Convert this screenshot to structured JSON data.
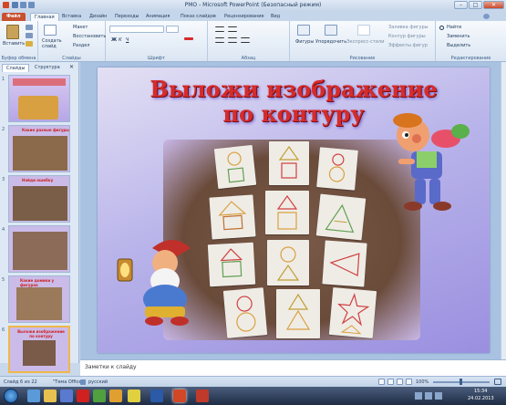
{
  "window": {
    "title": "РМО - Microsoft PowerPoint (Безопасный режим)",
    "controls": [
      "–",
      "□",
      "✕"
    ]
  },
  "tabs": [
    "Файл",
    "Главная",
    "Вставка",
    "Дизайн",
    "Переходы",
    "Анимация",
    "Показ слайдов",
    "Рецензирование",
    "Вид"
  ],
  "ribbon": {
    "clipboard": {
      "paste": "Вставить",
      "label": "Буфер обмена"
    },
    "slides": {
      "create": "Создать слайд",
      "layout": "Макет",
      "reset": "Восстановить",
      "section": "Раздел",
      "label": "Слайды"
    },
    "font": {
      "label": "Шрифт"
    },
    "paragraph": {
      "label": "Абзац"
    },
    "drawing": {
      "shapes": "Фигуры",
      "arrange": "Упорядочить",
      "quickstyles": "Экспресс-стили",
      "fill": "Заливка фигуры",
      "outline": "Контур фигуры",
      "effects": "Эффекты фигур",
      "label": "Рисование"
    },
    "editing": {
      "find": "Найти",
      "replace": "Заменить",
      "select": "Выделить",
      "label": "Редактирование"
    }
  },
  "panel": {
    "tab_slides": "Слайды",
    "tab_outline": "Структура",
    "thumbnails": [
      {
        "num": "1"
      },
      {
        "num": "2",
        "caption": "Какие разные фигуры"
      },
      {
        "num": "3",
        "caption": "Найди ошибку"
      },
      {
        "num": "4"
      },
      {
        "num": "5",
        "caption": "Какие домики у фигурок"
      },
      {
        "num": "6",
        "caption": "Выложи изображение по контуру"
      }
    ]
  },
  "slide": {
    "title": "Выложи изображение по контуру"
  },
  "notes": {
    "placeholder": "Заметки к слайду"
  },
  "status": {
    "slide_info": "Слайд 6 из 22",
    "theme": "\"Тема Office\"",
    "language": "русский",
    "zoom": "100%"
  },
  "taskbar": {
    "time": "15:34",
    "date": "24.02.2013"
  },
  "colors": {
    "file_tab": "#c8502f",
    "title_red": "#d62c2c",
    "slide_bg": "#b9b4ea"
  }
}
